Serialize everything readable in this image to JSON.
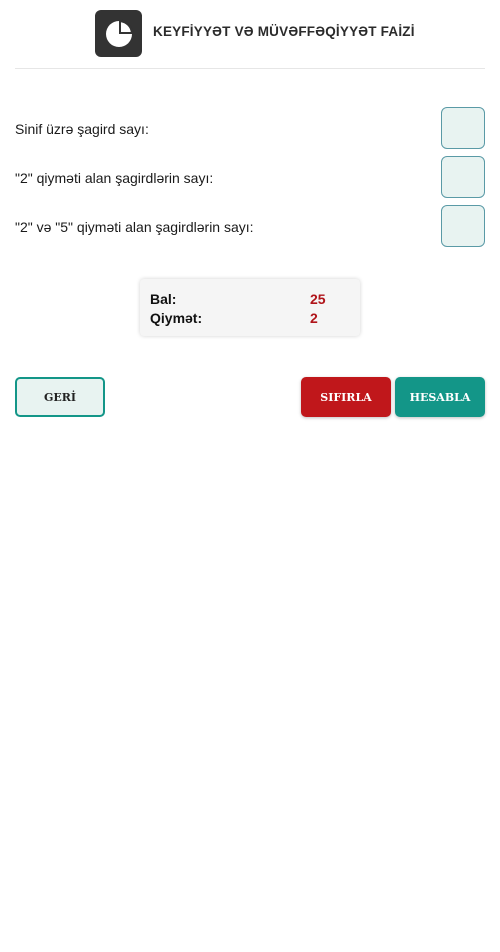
{
  "header": {
    "logo_icon": "pie-chart-icon",
    "title": "KEYFİYYƏT VƏ MÜVƏFFƏQİYYƏT FAİZİ"
  },
  "form": {
    "fields": [
      {
        "label": "Sinif üzrə şagird sayı:",
        "value": ""
      },
      {
        "label": "\"2\" qiymәti alan şagirdlәrin sayı:",
        "value": ""
      },
      {
        "label": "\"2\" vә \"5\" qiymәti alan şagirdlәrin sayı:",
        "value": ""
      }
    ]
  },
  "result": {
    "score_label": "Bal:",
    "score_value": "25",
    "grade_label": "Qiymәt:",
    "grade_value": "2"
  },
  "buttons": {
    "back_label": "GERİ",
    "reset_label": "SIFIRLA",
    "calculate_label": "HESABLA"
  },
  "colors": {
    "accent_teal": "#139688",
    "reset_red": "#c0171b",
    "value_red": "#b0141a",
    "input_bg": "#e8f3f1",
    "logo_bg": "#333333"
  }
}
